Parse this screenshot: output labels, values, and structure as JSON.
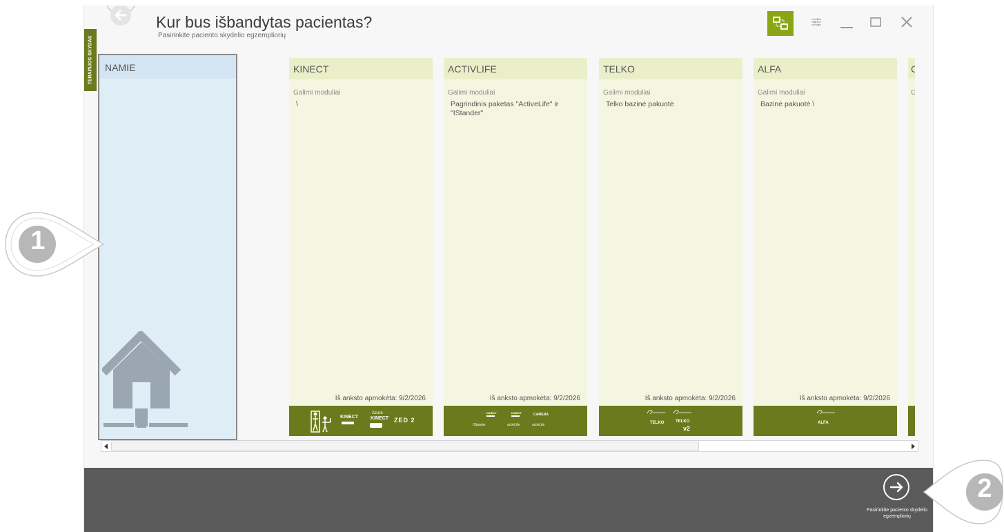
{
  "header": {
    "title": "Kur bus išbandytas pacientas?",
    "subtitle": "Pasirinkite paciento skydelio egzempliorių"
  },
  "side_tab": {
    "label": "TERAPIJOS SKYDAS"
  },
  "namie": {
    "name": "NAMIE"
  },
  "panels": [
    {
      "name": "KINECT",
      "modules_label": "Galimi moduliai",
      "modules": "\\",
      "prepaid": "Iš anksto apmokėta: 9/2/2026",
      "footer": {
        "l1": "KINECT",
        "l2a": "Azure",
        "l2b": "KINECT",
        "l3": "ZED 2"
      }
    },
    {
      "name": "ACTIVLIFE",
      "modules_label": "Galimi moduliai",
      "modules": "Pagrindinis paketas \"ActiveLife\" ir \"IStander\"",
      "prepaid": "Iš anksto apmokėta: 9/2/2026",
      "footer": {
        "k1": "KINECT",
        "k2": "KINECT",
        "cam": "CAMERA",
        "b1": "IStander",
        "b2": "activLife",
        "b3": "activLife"
      }
    },
    {
      "name": "TELKO",
      "modules_label": "Galimi moduliai",
      "modules": "Telko bazinė pakuotė",
      "prepaid": "Iš anksto apmokėta: 9/2/2026",
      "footer": {
        "t1": "TELKO",
        "t2": "TELKO",
        "v2": "v2"
      }
    },
    {
      "name": "ALFA",
      "modules_label": "Galimi moduliai",
      "modules": "Bazinė pakuotė \\",
      "prepaid": "Iš anksto apmokėta: 9/2/2026",
      "footer": {
        "a1": "ALFA"
      }
    },
    {
      "name": "C",
      "modules_label": "G"
    }
  ],
  "next": {
    "label": "Pasirinkite paciento skydelio egzempliorių"
  },
  "callouts": {
    "one": "1",
    "two": "2"
  },
  "colors": {
    "accent": "#6b7a1c",
    "topology": "#8ba614",
    "namie_bg": "#dfedf7",
    "panel_bg": "#f5f6e1"
  }
}
